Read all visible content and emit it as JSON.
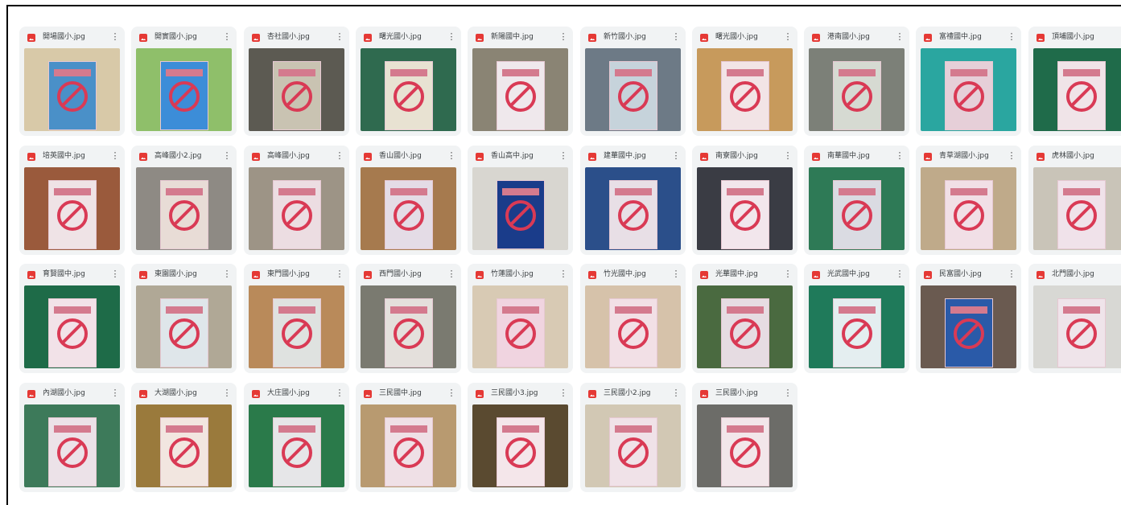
{
  "files": [
    {
      "name": "開場國小.jpg",
      "bg": "#d8c9a8",
      "accent": "#4a90c8"
    },
    {
      "name": "開實國小.jpg",
      "bg": "#8fbf6a",
      "accent": "#3c8dd8"
    },
    {
      "name": "杏社國小.jpg",
      "bg": "#5c5a52",
      "accent": "#c9c3b2"
    },
    {
      "name": "曙光國小.jpg",
      "bg": "#2f6a4f",
      "accent": "#e8e2d2"
    },
    {
      "name": "新陽國中.jpg",
      "bg": "#8a8474",
      "accent": "#efe8ec"
    },
    {
      "name": "新竹國小.jpg",
      "bg": "#6d7a86",
      "accent": "#c6d3db"
    },
    {
      "name": "曙光國小.jpg",
      "bg": "#c79a5c",
      "accent": "#f2e4e6"
    },
    {
      "name": "港南國小.jpg",
      "bg": "#7c8078",
      "accent": "#d6dad2"
    },
    {
      "name": "富禮國中.jpg",
      "bg": "#2aa6a0",
      "accent": "#e6cfd8"
    },
    {
      "name": "頂埔國小.jpg",
      "bg": "#1f6b4a",
      "accent": "#f0e4e8"
    },
    {
      "name": "培英國中.jpg",
      "bg": "#9a5a3c",
      "accent": "#efe3e6"
    },
    {
      "name": "高峰國小2.jpg",
      "bg": "#8e8a84",
      "accent": "#e8dcd6"
    },
    {
      "name": "高峰國小.jpg",
      "bg": "#9d9486",
      "accent": "#ecdde2"
    },
    {
      "name": "香山國小.jpg",
      "bg": "#a67a4e",
      "accent": "#e4dce6"
    },
    {
      "name": "香山高中.jpg",
      "bg": "#d8d6d0",
      "accent": "#1a3c8a"
    },
    {
      "name": "建華國中.jpg",
      "bg": "#2b4f8a",
      "accent": "#e8dfe6"
    },
    {
      "name": "南寮國小.jpg",
      "bg": "#3a3c44",
      "accent": "#f2e6ec"
    },
    {
      "name": "南華國中.jpg",
      "bg": "#2e7a56",
      "accent": "#dadbe2"
    },
    {
      "name": "青草湖國小.jpg",
      "bg": "#bfaa8a",
      "accent": "#f1dfe6"
    },
    {
      "name": "虎林國小.jpg",
      "bg": "#c9c4b8",
      "accent": "#f0e2ea"
    },
    {
      "name": "育賢國中.jpg",
      "bg": "#1e6b48",
      "accent": "#f2e2e8"
    },
    {
      "name": "東園國小.jpg",
      "bg": "#b0a896",
      "accent": "#dfe6ea"
    },
    {
      "name": "東門國小.jpg",
      "bg": "#b98a5a",
      "accent": "#dfe2e0"
    },
    {
      "name": "西門國小.jpg",
      "bg": "#7a7a70",
      "accent": "#e4e0dc"
    },
    {
      "name": "竹蓮國小.jpg",
      "bg": "#d8cab4",
      "accent": "#f0d4e0"
    },
    {
      "name": "竹光國中.jpg",
      "bg": "#d6c2aa",
      "accent": "#f2e0e6"
    },
    {
      "name": "光華國中.jpg",
      "bg": "#4a6a40",
      "accent": "#e6dce2"
    },
    {
      "name": "光武國中.jpg",
      "bg": "#1f7a5a",
      "accent": "#e4eef0"
    },
    {
      "name": "民富國小.jpg",
      "bg": "#6a5a50",
      "accent": "#2a5aa8"
    },
    {
      "name": "北門國小.jpg",
      "bg": "#d8d8d4",
      "accent": "#efe4ea"
    },
    {
      "name": "內湖國小.jpg",
      "bg": "#3d7a5a",
      "accent": "#ece2e8"
    },
    {
      "name": "大湖國小.jpg",
      "bg": "#9a7a3c",
      "accent": "#f2e6e0"
    },
    {
      "name": "大庄國小.jpg",
      "bg": "#2a7a4a",
      "accent": "#e6e6e8"
    },
    {
      "name": "三民國中.jpg",
      "bg": "#b89a70",
      "accent": "#efe0e6"
    },
    {
      "name": "三民國小3.jpg",
      "bg": "#5a4a30",
      "accent": "#f4e6ea"
    },
    {
      "name": "三民國小2.jpg",
      "bg": "#d2c8b4",
      "accent": "#f0e2e8"
    },
    {
      "name": "三民國小.jpg",
      "bg": "#6c6c68",
      "accent": "#f2e6ea"
    }
  ]
}
